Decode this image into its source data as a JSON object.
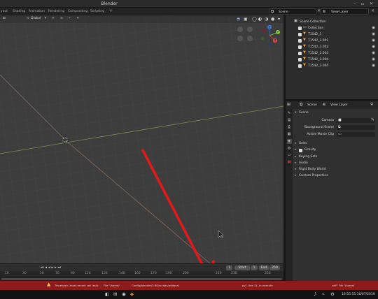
{
  "window": {
    "title": "Blender",
    "controls": "– ▫ ✕"
  },
  "workspaces": [
    {
      "label": "yout"
    },
    {
      "label": "Shading"
    },
    {
      "label": "Animation"
    },
    {
      "label": "Rendering"
    },
    {
      "label": "Compositing"
    },
    {
      "label": "Scripting"
    },
    {
      "label": "+"
    }
  ],
  "scene_selector": {
    "label": "Scene"
  },
  "view_layer_selector": {
    "label": "View Layer"
  },
  "viewport_header": {
    "transform_orientation": "Global",
    "dropdown_items": [
      "▾",
      "⤧",
      "⊙",
      "⌁",
      "▾"
    ],
    "shading_icons": [
      "◯",
      "◐",
      "◑",
      "●"
    ]
  },
  "timeline": {
    "start_label": "Start",
    "start_value": "1",
    "end_label": "End",
    "end_value": "250",
    "current_frame": "1",
    "ticks": [
      "10",
      "30",
      "50",
      "70",
      "90",
      "110",
      "130",
      "140",
      "160",
      "170",
      "190",
      "200",
      "220",
      "230",
      "250"
    ]
  },
  "status_bar": {
    "messages": [
      "Traceback (most recent call last):",
      "File \"/home/",
      "Config/blender/2.80/scripts/addons/",
      "py\", line 11, in execute",
      "self\" File \"/home/"
    ]
  },
  "taskbar": {
    "clock": "16:55:55 16/07/2019",
    "tray_icons": [
      "♪",
      "⌁",
      "⚙"
    ],
    "apps": [
      "◧",
      "⊞",
      "◉",
      "◆"
    ]
  },
  "outliner": {
    "items": [
      {
        "label": "Scene Collection",
        "type": "collection-root"
      },
      {
        "label": "Collection",
        "type": "collection"
      },
      {
        "label": "T1542_3",
        "type": "object"
      },
      {
        "label": "T1542_3.001",
        "type": "object"
      },
      {
        "label": "T1542_3.002",
        "type": "object"
      },
      {
        "label": "T1542_3.003",
        "type": "object"
      },
      {
        "label": "T1542_3.004",
        "type": "object"
      },
      {
        "label": "T1542_3.005",
        "type": "object"
      }
    ]
  },
  "properties": {
    "header_scene": "Scene",
    "header_view_layer": "View Layer",
    "scene_panel": {
      "title": "Scene",
      "camera_label": "Camera",
      "background_scene_label": "Background Scene",
      "active_movie_clip_label": "Active Movie Clip"
    },
    "units_label": "Units",
    "gravity_label": "Gravity",
    "keying_sets_label": "Keying Sets",
    "audio_label": "Audio",
    "rigid_body_world_label": "Rigid Body World",
    "custom_properties_label": "Custom Properties"
  },
  "gizmo": {
    "x": "X",
    "y": "Y",
    "z": "Z"
  },
  "colors": {
    "annotation_red": "#e01a1a",
    "status_bar_error": "#8d1b1b",
    "outliner_object": "#ee9b4b",
    "grid_x_axis": "#8a6a5a",
    "grid_y_axis": "#7b8d52"
  }
}
